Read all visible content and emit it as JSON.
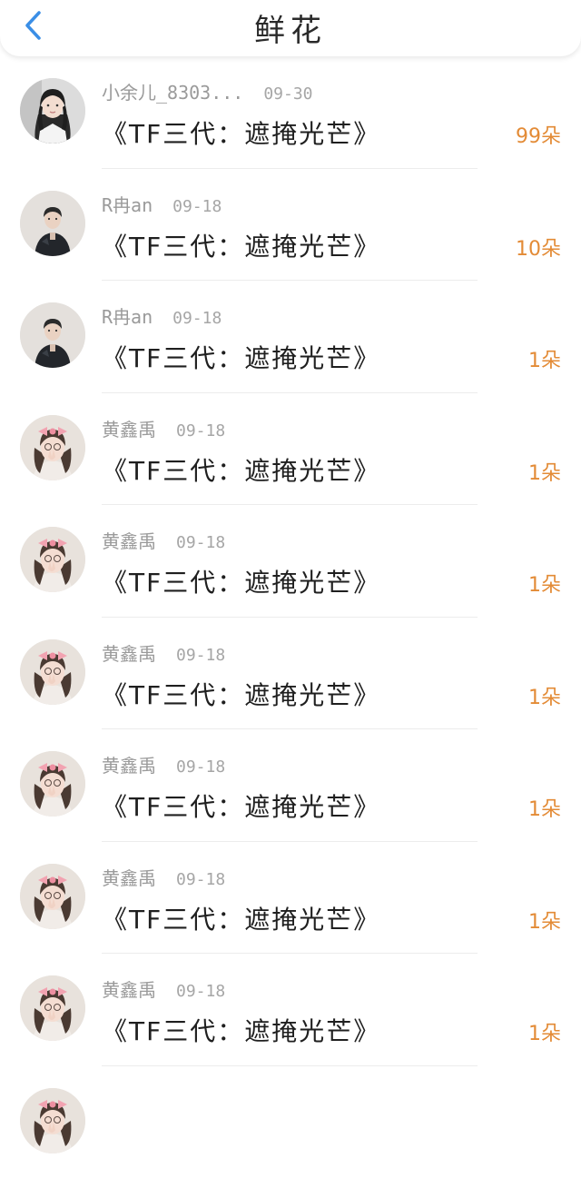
{
  "header": {
    "title": "鲜花",
    "back_icon": "chevron-left-icon",
    "accent_color": "#3a8ee6"
  },
  "count_color": "#e38b36",
  "rows": [
    {
      "user": "小余儿_8303...",
      "date": "09-30",
      "book": "《TF三代：遮掩光芒》",
      "count": "99朵",
      "avatar": "girl-long-hair"
    },
    {
      "user": "R冉an",
      "date": "09-18",
      "book": "《TF三代：遮掩光芒》",
      "count": "10朵",
      "avatar": "boy-dark-jacket"
    },
    {
      "user": "R冉an",
      "date": "09-18",
      "book": "《TF三代：遮掩光芒》",
      "count": "1朵",
      "avatar": "boy-dark-jacket"
    },
    {
      "user": "黄鑫禹",
      "date": "09-18",
      "book": "《TF三代：遮掩光芒》",
      "count": "1朵",
      "avatar": "girl-pink-bow"
    },
    {
      "user": "黄鑫禹",
      "date": "09-18",
      "book": "《TF三代：遮掩光芒》",
      "count": "1朵",
      "avatar": "girl-pink-bow"
    },
    {
      "user": "黄鑫禹",
      "date": "09-18",
      "book": "《TF三代：遮掩光芒》",
      "count": "1朵",
      "avatar": "girl-pink-bow"
    },
    {
      "user": "黄鑫禹",
      "date": "09-18",
      "book": "《TF三代：遮掩光芒》",
      "count": "1朵",
      "avatar": "girl-pink-bow"
    },
    {
      "user": "黄鑫禹",
      "date": "09-18",
      "book": "《TF三代：遮掩光芒》",
      "count": "1朵",
      "avatar": "girl-pink-bow"
    },
    {
      "user": "黄鑫禹",
      "date": "09-18",
      "book": "《TF三代：遮掩光芒》",
      "count": "1朵",
      "avatar": "girl-pink-bow"
    },
    {
      "user": "",
      "date": "",
      "book": "",
      "count": "",
      "avatar": "girl-pink-bow"
    }
  ]
}
